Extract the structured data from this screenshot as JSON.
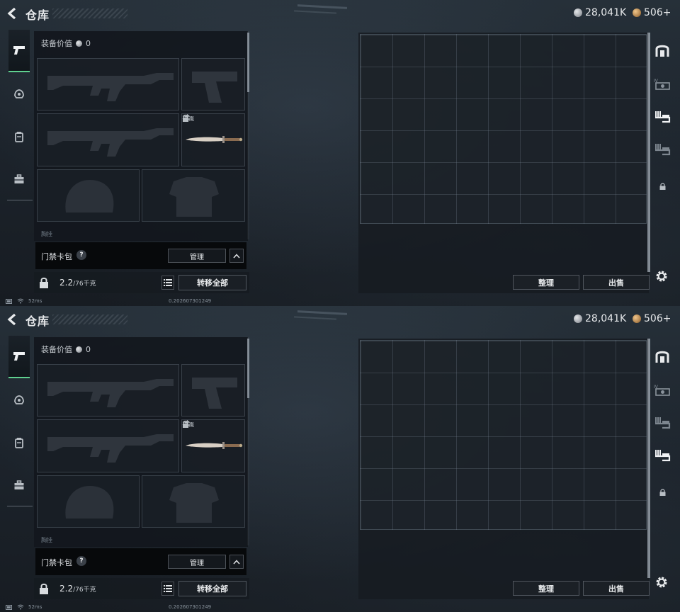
{
  "screens": [
    {
      "title": "仓库",
      "currency": {
        "silver": "28,041K",
        "bronze": "506+"
      },
      "equipment_value_label": "装备价值",
      "equipment_value": "0",
      "knife_name": "黑鹰",
      "section_label": "胸挂",
      "keycard_label": "门禁卡包",
      "help": "?",
      "manage_label": "管理",
      "weight_current": "2.2",
      "weight_capacity": "/76千克",
      "transfer_all_label": "转移全部",
      "sort_label": "整理",
      "sell_label": "出售",
      "ping": "52ms",
      "build": "0.202607301249",
      "active_right_tab": 2
    },
    {
      "title": "仓库",
      "currency": {
        "silver": "28,041K",
        "bronze": "506+"
      },
      "equipment_value_label": "装备价值",
      "equipment_value": "0",
      "knife_name": "黑鹰",
      "section_label": "胸挂",
      "keycard_label": "门禁卡包",
      "help": "?",
      "manage_label": "管理",
      "weight_current": "2.2",
      "weight_capacity": "/76千克",
      "transfer_all_label": "转移全部",
      "sort_label": "整理",
      "sell_label": "出售",
      "ping": "52ms",
      "build": "0.202607301249",
      "active_right_tab": 3
    }
  ],
  "colors": {
    "accent": "#5fd08f",
    "panel": "#12171d",
    "text": "#d4d8dc"
  },
  "icons": [
    "back-arrow-icon",
    "pistol-icon",
    "helmet-icon",
    "backpack-icon",
    "briefcase-icon",
    "silver-coin-icon",
    "bronze-coin-icon",
    "rifle-icon",
    "knife-icon",
    "swap-icon",
    "lock-icon",
    "help-icon",
    "chevron-up-icon",
    "list-icon",
    "helmet-silhouette-icon",
    "vest-silhouette-icon",
    "safe-icon",
    "storage-expansion-icon",
    "settings-gear-icon",
    "wifi-icon"
  ]
}
